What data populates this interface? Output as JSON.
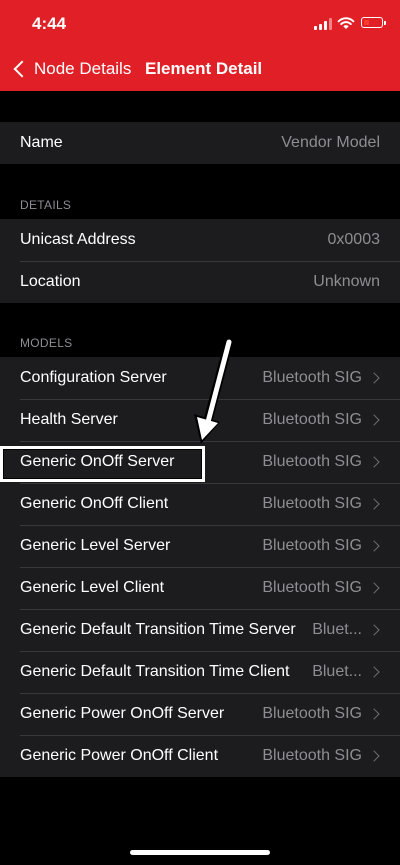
{
  "status_bar": {
    "time": "4:44"
  },
  "nav": {
    "back_label": "Node Details",
    "title": "Element Detail"
  },
  "name_section": {
    "label": "Name",
    "value": "Vendor Model"
  },
  "details_section": {
    "header": "DETAILS",
    "rows": [
      {
        "label": "Unicast Address",
        "value": "0x0003"
      },
      {
        "label": "Location",
        "value": "Unknown"
      }
    ]
  },
  "models_section": {
    "header": "MODELS",
    "rows": [
      {
        "label": "Configuration Server",
        "value": "Bluetooth SIG"
      },
      {
        "label": "Health Server",
        "value": "Bluetooth SIG"
      },
      {
        "label": "Generic OnOff Server",
        "value": "Bluetooth SIG"
      },
      {
        "label": "Generic OnOff Client",
        "value": "Bluetooth SIG"
      },
      {
        "label": "Generic Level Server",
        "value": "Bluetooth SIG"
      },
      {
        "label": "Generic Level Client",
        "value": "Bluetooth SIG"
      },
      {
        "label": "Generic Default Transition Time Server",
        "value": "Bluet..."
      },
      {
        "label": "Generic Default Transition Time Client",
        "value": "Bluet..."
      },
      {
        "label": "Generic Power OnOff Server",
        "value": "Bluetooth SIG"
      },
      {
        "label": "Generic Power OnOff Client",
        "value": "Bluetooth SIG"
      }
    ]
  },
  "colors": {
    "accent": "#e01f26",
    "background": "#000000",
    "cell": "#1c1c1e",
    "secondary_text": "#8d8d93"
  }
}
